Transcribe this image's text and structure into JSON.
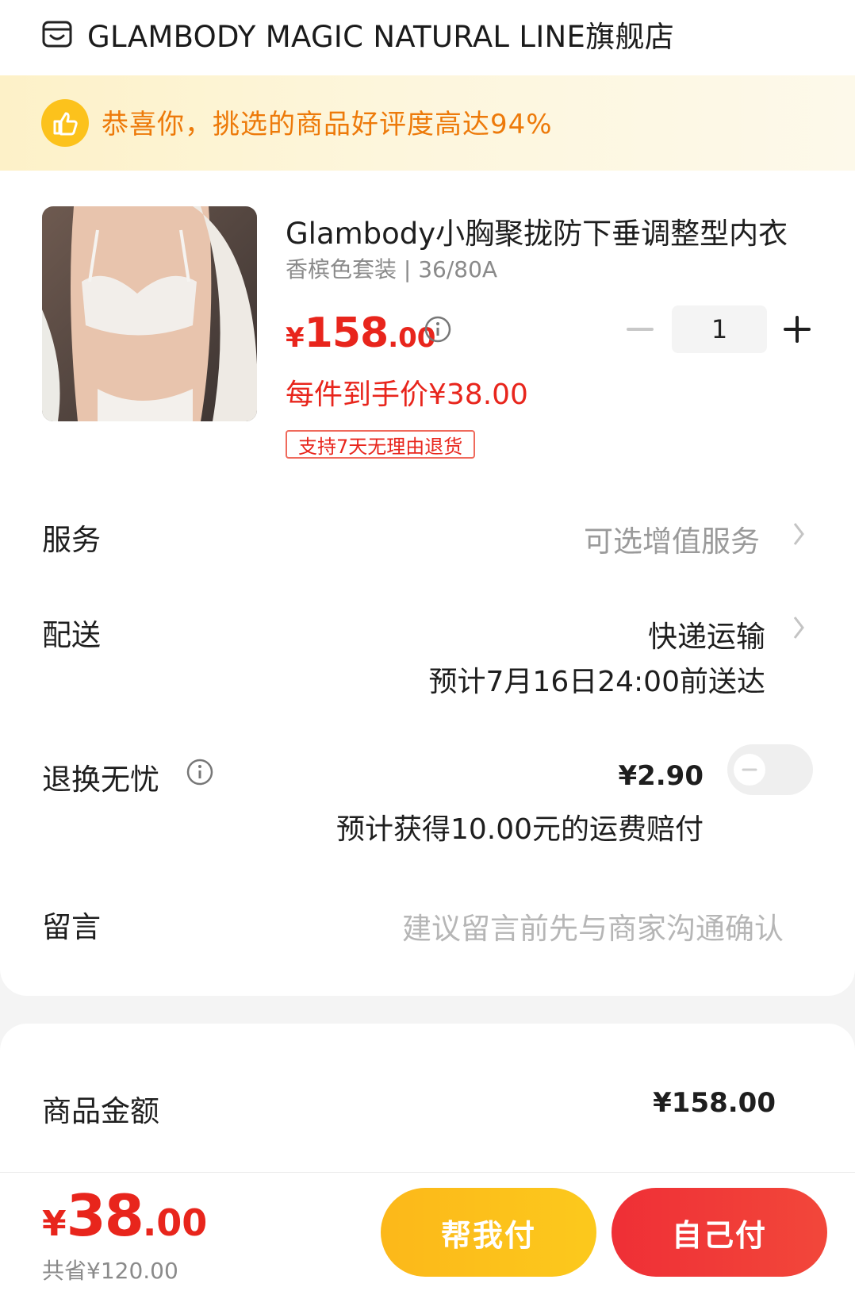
{
  "store": {
    "name": "GLAMBODY MAGIC NATURAL LINE旗舰店"
  },
  "banner": {
    "text": "恭喜你，挑选的商品好评度高达94%"
  },
  "product": {
    "title": "Glambody小胸聚拢防下垂调整型内衣",
    "sku": "香槟色套装 | 36/80A",
    "price_currency": "¥",
    "price_int": "158",
    "price_dec": ".00",
    "unit_price": "每件到手价¥38.00",
    "return_tag": "支持7天无理由退货",
    "quantity": "1"
  },
  "rows": {
    "service_label": "服务",
    "service_value": "可选增值服务",
    "delivery_label": "配送",
    "delivery_value": "快递运输",
    "delivery_eta": "预计7月16日24:00前送达",
    "worry_label": "退换无忧",
    "worry_price": "¥2.90",
    "worry_comp": "预计获得10.00元的运费赔付",
    "worry_enabled": false,
    "message_label": "留言",
    "message_placeholder": "建议留言前先与商家沟通确认"
  },
  "summary": {
    "goods_label": "商品金额",
    "goods_amount": "¥158.00"
  },
  "footer": {
    "total_currency": "¥",
    "total_int": "38",
    "total_dec": ".00",
    "saved": "共省¥120.00",
    "help_pay": "帮我付",
    "self_pay": "自己付"
  },
  "colors": {
    "accent_red": "#e8251c",
    "orange": "#ed7a0a",
    "yellow": "#fcc21c"
  }
}
